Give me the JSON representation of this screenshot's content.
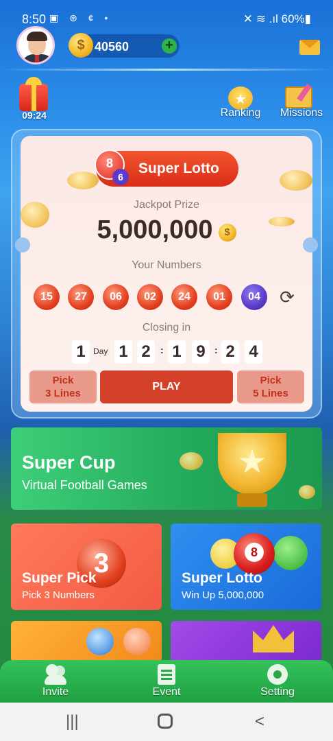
{
  "status_bar": {
    "time": "8:50",
    "left_icons": "▣ ⊛ ¢ •",
    "right": "✕ ≋ .ıl 60%▮"
  },
  "header": {
    "coins": "40560",
    "coin_symbol": "$",
    "add_symbol": "+"
  },
  "quick": {
    "gift_timer": "09:24",
    "ranking_label": "Ranking",
    "missions_label": "Missions"
  },
  "lotto_card": {
    "title": "Super Lotto",
    "ball_main": "8",
    "ball_small": "6",
    "jackpot_label": "Jackpot Prize",
    "jackpot_value": "5,000,000",
    "your_numbers_label": "Your Numbers",
    "numbers": [
      "15",
      "27",
      "06",
      "02",
      "24",
      "01"
    ],
    "bonus_number": "04",
    "closing_label": "Closing in",
    "countdown": {
      "day": "1",
      "day_label": "Day",
      "h1": "1",
      "h2": "2",
      "m1": "1",
      "m2": "9",
      "s1": "2",
      "s2": "4"
    },
    "pick3_label_1": "Pick",
    "pick3_label_2": "3 Lines",
    "play_label": "PLAY",
    "pick5_label_1": "Pick",
    "pick5_label_2": "5 Lines"
  },
  "super_cup": {
    "title": "Super Cup",
    "subtitle": "Virtual Football Games"
  },
  "tiles": {
    "super_pick": {
      "title": "Super Pick",
      "subtitle": "Pick 3 Numbers",
      "ball": "3"
    },
    "super_lotto": {
      "title": "Super Lotto",
      "subtitle": "Win Up 5,000,000",
      "ball": "8"
    }
  },
  "bottom_nav": {
    "invite": "Invite",
    "event": "Event",
    "setting": "Setting"
  },
  "android_nav": {
    "recents": "|||",
    "back": "<"
  },
  "colors": {
    "accent_red": "#d4412a",
    "bonus_purple": "#5a3ac8",
    "nav_green": "#1fa042"
  }
}
